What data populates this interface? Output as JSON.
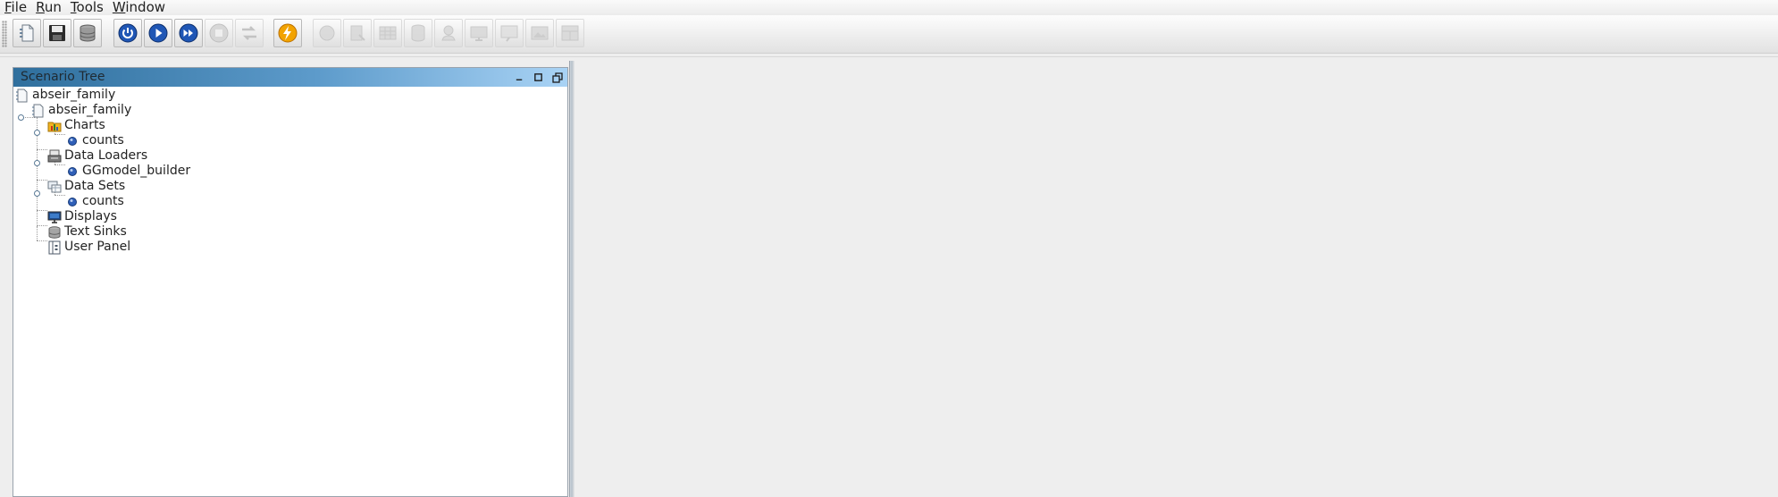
{
  "menu": {
    "items": [
      {
        "mnemonic": "F",
        "rest": "ile"
      },
      {
        "mnemonic": "R",
        "rest": "un"
      },
      {
        "mnemonic": "T",
        "rest": "ools"
      },
      {
        "mnemonic": "W",
        "rest": "indow"
      }
    ]
  },
  "toolbar": {
    "buttons": [
      {
        "name": "new-scenario-icon",
        "enabled": true
      },
      {
        "name": "save-icon",
        "enabled": true
      },
      {
        "name": "database-icon",
        "enabled": true
      },
      {
        "name": "initialize-icon",
        "enabled": true
      },
      {
        "name": "run-icon",
        "enabled": true
      },
      {
        "name": "step-forward-icon",
        "enabled": true
      },
      {
        "name": "stop-icon",
        "enabled": false
      },
      {
        "name": "reset-icon",
        "enabled": false
      },
      {
        "name": "lightning-icon",
        "enabled": true
      },
      {
        "name": "disabled-tool-1-icon",
        "enabled": false
      },
      {
        "name": "disabled-tool-2-icon",
        "enabled": false
      },
      {
        "name": "disabled-tool-3-icon",
        "enabled": false
      },
      {
        "name": "disabled-tool-4-icon",
        "enabled": false
      },
      {
        "name": "disabled-tool-5-icon",
        "enabled": false
      },
      {
        "name": "disabled-tool-6-icon",
        "enabled": false
      },
      {
        "name": "disabled-tool-7-icon",
        "enabled": false
      },
      {
        "name": "disabled-tool-8-icon",
        "enabled": false
      },
      {
        "name": "disabled-tool-9-icon",
        "enabled": false
      }
    ]
  },
  "panel": {
    "title": "Scenario Tree"
  },
  "tree": {
    "root": "abseir_family",
    "scenario": "abseir_family",
    "charts": "Charts",
    "chart_item": "counts",
    "data_loaders": "Data Loaders",
    "loader_item": "GGmodel_builder",
    "data_sets": "Data Sets",
    "dataset_item": "counts",
    "displays": "Displays",
    "text_sinks": "Text Sinks",
    "user_panel": "User Panel"
  },
  "colors": {
    "header_start": "#2f6f9d",
    "header_end": "#a9d3f5",
    "leaf_bullet": "#2f5fb8"
  }
}
